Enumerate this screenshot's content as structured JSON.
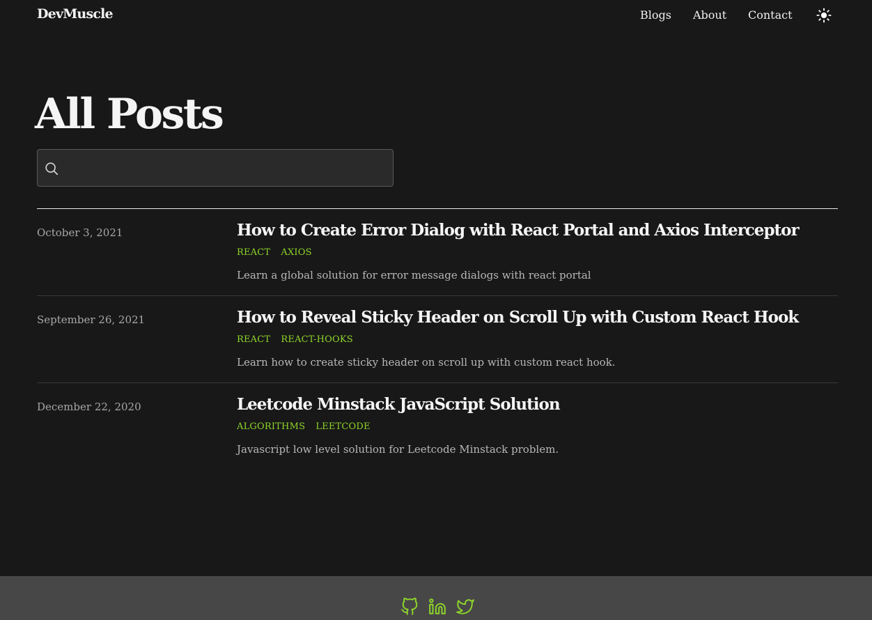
{
  "header": {
    "logo": "DevMuscle",
    "nav": [
      {
        "label": "Blogs"
      },
      {
        "label": "About"
      },
      {
        "label": "Contact"
      }
    ],
    "theme_toggle_icon": "sun-icon"
  },
  "main": {
    "title": "All Posts",
    "search": {
      "placeholder": "",
      "value": "",
      "icon": "search-icon"
    }
  },
  "posts": [
    {
      "date": "October 3, 2021",
      "title": "How to Create Error Dialog with React Portal and Axios Interceptor",
      "tags": [
        "REACT",
        "AXIOS"
      ],
      "description": "Learn a global solution for error message dialogs with react portal"
    },
    {
      "date": "September 26, 2021",
      "title": "How to Reveal Sticky Header on Scroll Up with Custom React Hook",
      "tags": [
        "REACT",
        "REACT-HOOKS"
      ],
      "description": "Learn how to create sticky header on scroll up with custom react hook."
    },
    {
      "date": "December 22, 2020",
      "title": "Leetcode Minstack JavaScript Solution",
      "tags": [
        "ALGORITHMS",
        "LEETCODE"
      ],
      "description": "Javascript low level solution for Leetcode Minstack problem."
    }
  ],
  "footer": {
    "social": [
      "github-icon",
      "linkedin-icon",
      "twitter-icon"
    ]
  },
  "colors": {
    "background": "#181818",
    "footer": "#474747",
    "accent": "#8fd62a",
    "text": "#f5f5f5",
    "muted": "#b8b8b8"
  }
}
